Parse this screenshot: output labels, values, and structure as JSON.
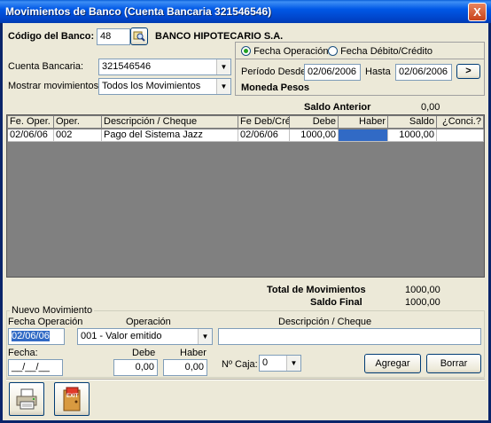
{
  "window": {
    "title": "Movimientos de Banco (Cuenta Bancaria 321546546)",
    "close_glyph": "X"
  },
  "header": {
    "codigo_label": "Código del Banco:",
    "codigo_value": "48",
    "banco_nombre": "BANCO HIPOTECARIO S.A.",
    "cuenta_label": "Cuenta Bancaria:",
    "cuenta_value": "321546546",
    "mostrar_label": "Mostrar movimientos:",
    "mostrar_value": "Todos los Movimientos"
  },
  "filter": {
    "radio_operacion": "Fecha Operación",
    "radio_debito": "Fecha Débito/Crédito",
    "desde_label": "Período Desde",
    "desde_value": "02/06/2006",
    "hasta_label": "Hasta",
    "hasta_value": "02/06/2006",
    "go_glyph": ">",
    "moneda": "Moneda Pesos"
  },
  "saldo_anterior": {
    "label": "Saldo Anterior",
    "value": "0,00"
  },
  "grid": {
    "columns": [
      "Fe. Oper.",
      "Oper.",
      "Descripción / Cheque",
      "Fe Deb/Cré",
      "Debe",
      "Haber",
      "Saldo",
      "¿Conci.?"
    ],
    "rows": [
      {
        "fe_oper": "02/06/06",
        "oper": "002",
        "descripcion": "Pago del Sistema Jazz",
        "fe_deb": "02/06/06",
        "debe": "1000,00",
        "haber": "",
        "saldo": "1000,00",
        "conci": ""
      }
    ]
  },
  "totals": {
    "total_label": "Total de Movimientos",
    "total_value": "1000,00",
    "saldo_final_label": "Saldo Final",
    "saldo_final_value": "1000,00"
  },
  "nuevo": {
    "group_label": "Nuevo Movimiento",
    "fecha_op_label": "Fecha Operación",
    "fecha_op_value": "02/06/06",
    "operacion_label": "Operación",
    "operacion_value": "001 - Valor emitido",
    "descripcion_label": "Descripción / Cheque",
    "descripcion_value": "",
    "fecha_label": "Fecha:",
    "fecha_value": "__/__/__",
    "debe_label": "Debe",
    "debe_value": "0,00",
    "haber_label": "Haber",
    "haber_value": "0,00",
    "caja_label": "Nº Caja:",
    "caja_value": "0",
    "agregar": "Agregar",
    "borrar": "Borrar"
  },
  "icons": {
    "search": "search-icon",
    "print": "print-icon",
    "exit": "exit-icon",
    "exit_text": "EXIT"
  },
  "colors": {
    "title_bar": "#0054e3",
    "selected_cell": "#316ac5",
    "grid_bg": "#808080"
  }
}
